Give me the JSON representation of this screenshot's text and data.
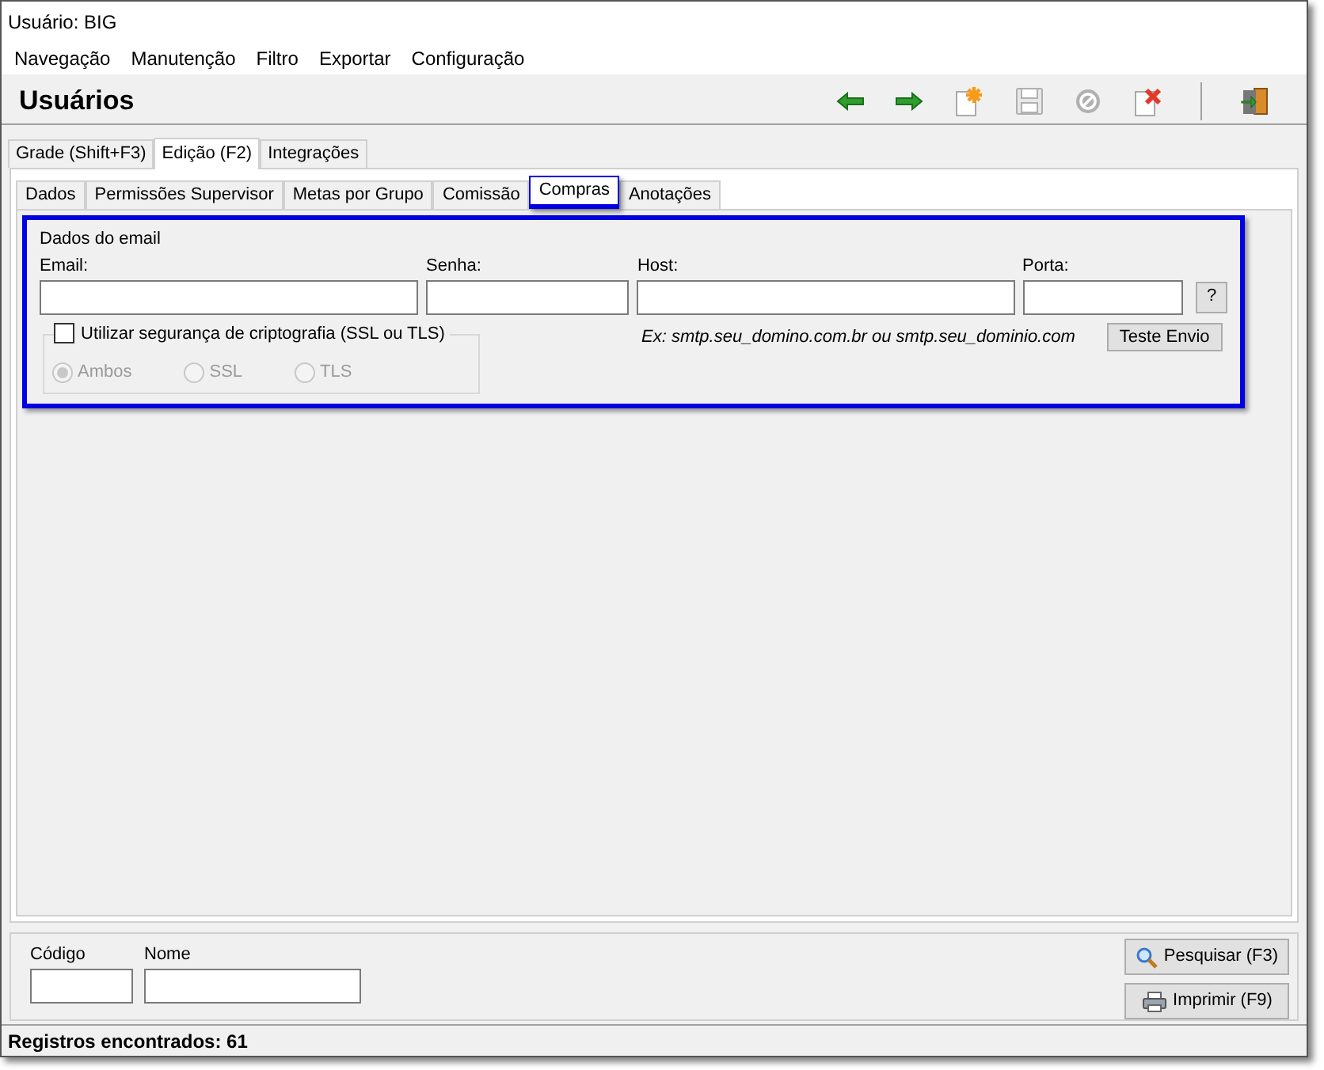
{
  "window": {
    "title": "Usuário: BIG"
  },
  "menu": [
    "Navegação",
    "Manutenção",
    "Filtro",
    "Exportar",
    "Configuração"
  ],
  "header": {
    "title": "Usuários"
  },
  "toolbar": [
    {
      "kind": "back",
      "disabled": false
    },
    {
      "kind": "forward",
      "disabled": false
    },
    {
      "kind": "new",
      "disabled": false
    },
    {
      "kind": "save",
      "disabled": true
    },
    {
      "kind": "cancel",
      "disabled": true
    },
    {
      "kind": "delete",
      "disabled": false
    },
    {
      "kind": "separator"
    },
    {
      "kind": "exit",
      "disabled": false
    }
  ],
  "tabs": [
    {
      "label": "Grade (Shift+F3)",
      "selected": false
    },
    {
      "label": "Edição (F2)",
      "selected": true
    },
    {
      "label": "Integrações",
      "selected": false
    }
  ],
  "subtabs": [
    {
      "label": "Dados",
      "selected": false,
      "highlighted": false
    },
    {
      "label": "Permissões Supervisor",
      "selected": false,
      "highlighted": false
    },
    {
      "label": "Metas por Grupo",
      "selected": false,
      "highlighted": false
    },
    {
      "label": "Comissão",
      "selected": false,
      "highlighted": false
    },
    {
      "label": "Compras",
      "selected": true,
      "highlighted": true
    },
    {
      "label": "Anotações",
      "selected": false,
      "highlighted": false
    }
  ],
  "email_group": {
    "title": "Dados do email",
    "highlighted": true,
    "email": {
      "label": "Email:"
    },
    "senha": {
      "label": "Senha:"
    },
    "host": {
      "label": "Host:"
    },
    "porta": {
      "label": "Porta:"
    },
    "help_button": "?",
    "hint": "Ex: smtp.seu_domino.com.br ou smtp.seu_dominio.com",
    "test_button": "Teste Envio",
    "security": {
      "label": "Utilizar segurança de criptografia (SSL ou TLS)",
      "checked": false,
      "options": [
        {
          "label": "Ambos",
          "selected": true,
          "disabled": true
        },
        {
          "label": "SSL",
          "selected": false,
          "disabled": true
        },
        {
          "label": "TLS",
          "selected": false,
          "disabled": true
        }
      ]
    }
  },
  "search": {
    "codigo": {
      "label": "Código"
    },
    "nome": {
      "label": "Nome"
    },
    "buttons": [
      {
        "kind": "search",
        "label": "Pesquisar (F3)"
      },
      {
        "kind": "print",
        "label": "Imprimir (F9)"
      }
    ]
  },
  "status_bar": "Registros encontrados: 61"
}
